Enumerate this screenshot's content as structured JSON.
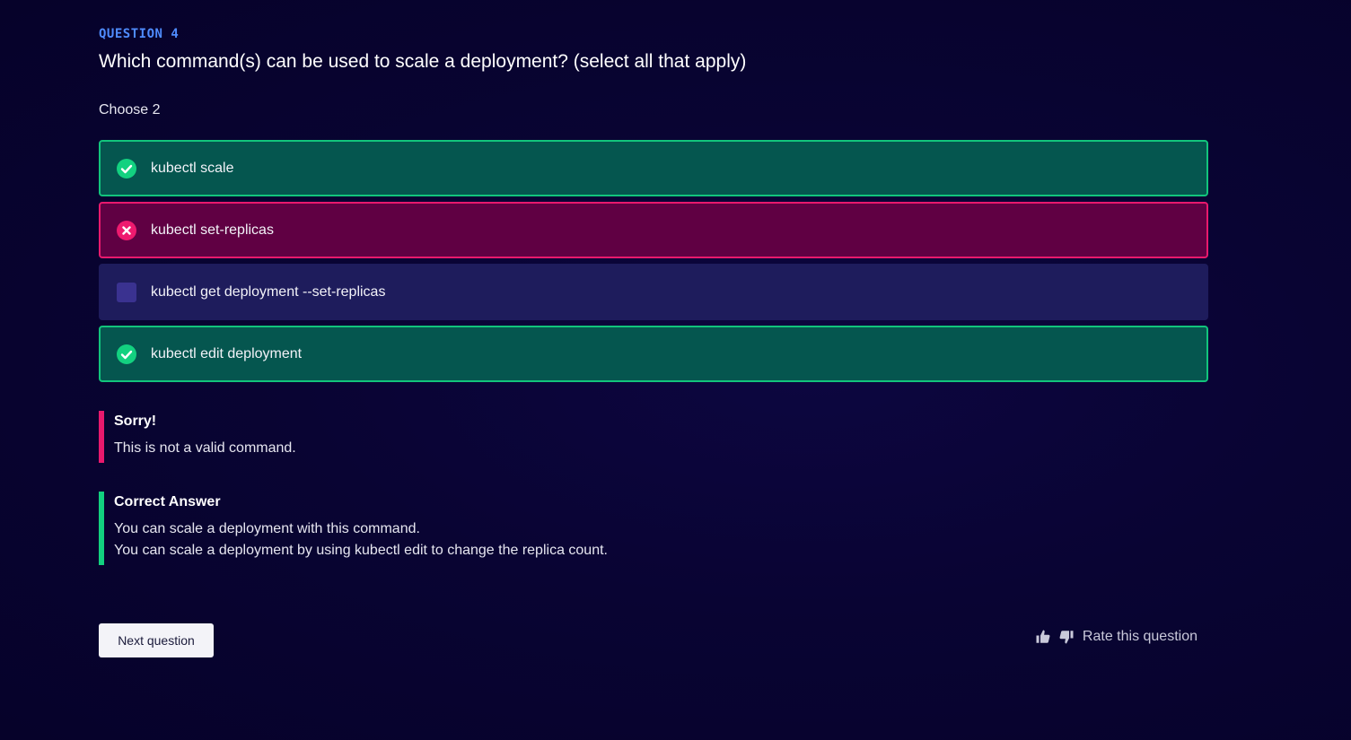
{
  "question": {
    "label": "QUESTION 4",
    "text": "Which command(s) can be used to scale a deployment? (select all that apply)",
    "instruction": "Choose 2"
  },
  "options": [
    {
      "label": "kubectl scale",
      "state": "correct",
      "icon": "check-circle-icon"
    },
    {
      "label": "kubectl set-replicas",
      "state": "wrong",
      "icon": "x-circle-icon"
    },
    {
      "label": "kubectl get deployment --set-replicas",
      "state": "unselected",
      "icon": "checkbox-icon"
    },
    {
      "label": "kubectl edit deployment",
      "state": "correct",
      "icon": "check-circle-icon"
    }
  ],
  "feedback": {
    "wrong": {
      "title": "Sorry!",
      "lines": [
        "This is not a valid command."
      ]
    },
    "correct": {
      "title": "Correct Answer",
      "lines": [
        "You can scale a deployment with this command.",
        "You can scale a deployment by using kubectl edit to change the replica count."
      ]
    }
  },
  "footer": {
    "next_label": "Next question",
    "rate_label": "Rate this question",
    "thumbs_up_icon": "thumbs-up-icon",
    "thumbs_down_icon": "thumbs-down-icon"
  },
  "colors": {
    "accent_blue": "#4f8cff",
    "correct_green": "#12c47c",
    "wrong_pink": "#e8196d",
    "neutral_purple": "#1e1c5c",
    "background": "#090433"
  }
}
